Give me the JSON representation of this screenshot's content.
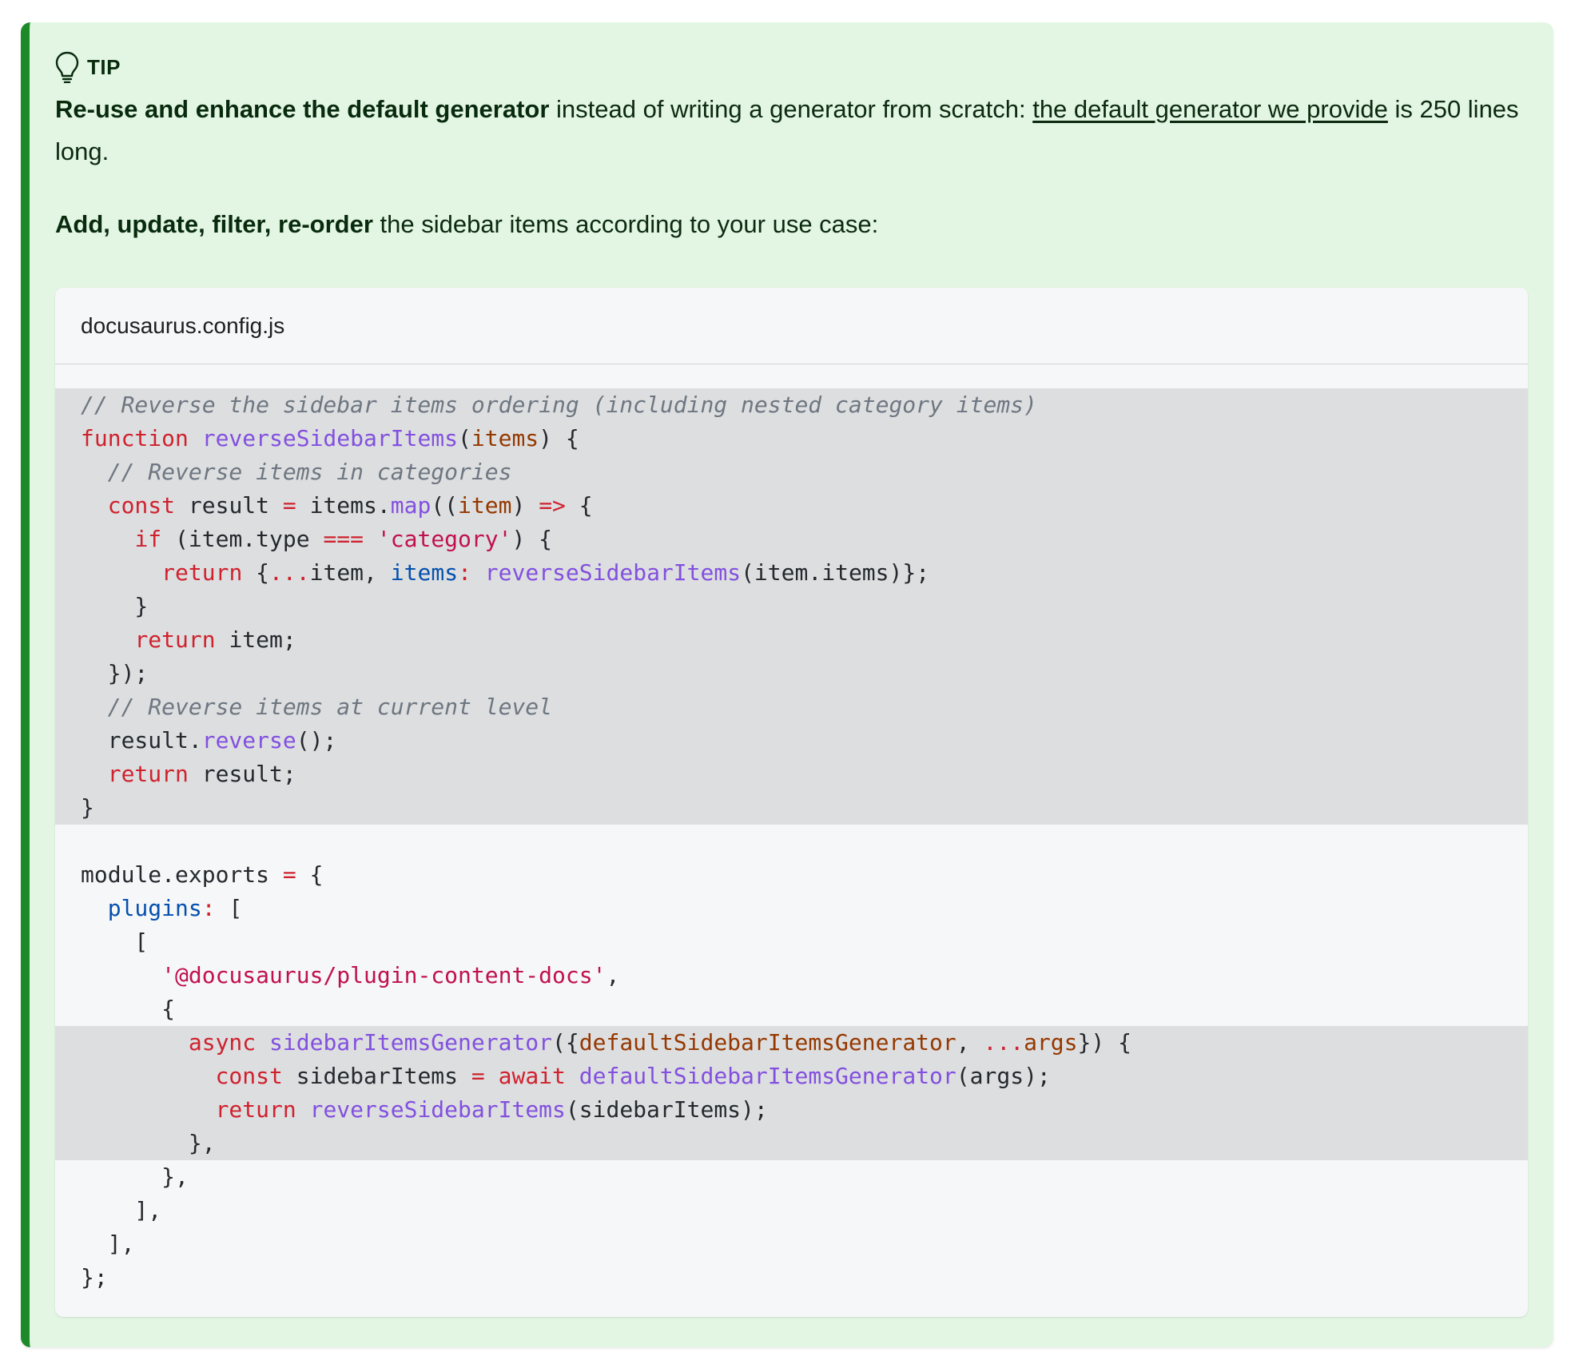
{
  "admonition": {
    "label": "tip",
    "icon": "lightbulb-icon",
    "paragraph1": {
      "bold": "Re-use and enhance the default generator",
      "text1": " instead of writing a generator from scratch: ",
      "link": "the default generator we provide",
      "text2": " is 250 lines long."
    },
    "paragraph2": {
      "bold": "Add, update, filter, re-order",
      "text": " the sidebar items according to your use case:"
    }
  },
  "code": {
    "title": "docusaurus.config.js",
    "lines": [
      {
        "hl": true,
        "tokens": [
          [
            "cm",
            "// Reverse the sidebar items ordering (including nested category items)"
          ]
        ]
      },
      {
        "hl": true,
        "tokens": [
          [
            "kw",
            "function"
          ],
          [
            "pl",
            " "
          ],
          [
            "fn",
            "reverseSidebarItems"
          ],
          [
            "pl",
            "("
          ],
          [
            "pr",
            "items"
          ],
          [
            "pl",
            ") {"
          ]
        ]
      },
      {
        "hl": true,
        "tokens": [
          [
            "pl",
            "  "
          ],
          [
            "cm",
            "// Reverse items in categories"
          ]
        ]
      },
      {
        "hl": true,
        "tokens": [
          [
            "pl",
            "  "
          ],
          [
            "kw",
            "const"
          ],
          [
            "pl",
            " result "
          ],
          [
            "op",
            "="
          ],
          [
            "pl",
            " items."
          ],
          [
            "fn",
            "map"
          ],
          [
            "pl",
            "(("
          ],
          [
            "pr",
            "item"
          ],
          [
            "pl",
            ") "
          ],
          [
            "op",
            "=>"
          ],
          [
            "pl",
            " {"
          ]
        ]
      },
      {
        "hl": true,
        "tokens": [
          [
            "pl",
            "    "
          ],
          [
            "kw",
            "if"
          ],
          [
            "pl",
            " (item.type "
          ],
          [
            "op",
            "==="
          ],
          [
            "pl",
            " "
          ],
          [
            "st",
            "'category'"
          ],
          [
            "pl",
            ") {"
          ]
        ]
      },
      {
        "hl": true,
        "tokens": [
          [
            "pl",
            "      "
          ],
          [
            "kw",
            "return"
          ],
          [
            "pl",
            " {"
          ],
          [
            "op",
            "..."
          ],
          [
            "pl",
            "item, "
          ],
          [
            "key",
            "items"
          ],
          [
            "op",
            ":"
          ],
          [
            "pl",
            " "
          ],
          [
            "fn",
            "reverseSidebarItems"
          ],
          [
            "pl",
            "(item.items)};"
          ]
        ]
      },
      {
        "hl": true,
        "tokens": [
          [
            "pl",
            "    }"
          ]
        ]
      },
      {
        "hl": true,
        "tokens": [
          [
            "pl",
            "    "
          ],
          [
            "kw",
            "return"
          ],
          [
            "pl",
            " item;"
          ]
        ]
      },
      {
        "hl": true,
        "tokens": [
          [
            "pl",
            "  });"
          ]
        ]
      },
      {
        "hl": true,
        "tokens": [
          [
            "pl",
            "  "
          ],
          [
            "cm",
            "// Reverse items at current level"
          ]
        ]
      },
      {
        "hl": true,
        "tokens": [
          [
            "pl",
            "  result."
          ],
          [
            "fn",
            "reverse"
          ],
          [
            "pl",
            "();"
          ]
        ]
      },
      {
        "hl": true,
        "tokens": [
          [
            "pl",
            "  "
          ],
          [
            "kw",
            "return"
          ],
          [
            "pl",
            " result;"
          ]
        ]
      },
      {
        "hl": true,
        "tokens": [
          [
            "pl",
            "}"
          ]
        ]
      },
      {
        "hl": false,
        "tokens": [
          [
            "pl",
            " "
          ]
        ]
      },
      {
        "hl": false,
        "tokens": [
          [
            "pl",
            "module.exports "
          ],
          [
            "op",
            "="
          ],
          [
            "pl",
            " {"
          ]
        ]
      },
      {
        "hl": false,
        "tokens": [
          [
            "pl",
            "  "
          ],
          [
            "key",
            "plugins"
          ],
          [
            "op",
            ":"
          ],
          [
            "pl",
            " ["
          ]
        ]
      },
      {
        "hl": false,
        "tokens": [
          [
            "pl",
            "    ["
          ]
        ]
      },
      {
        "hl": false,
        "tokens": [
          [
            "pl",
            "      "
          ],
          [
            "st",
            "'@docusaurus/plugin-content-docs'"
          ],
          [
            "pl",
            ","
          ]
        ]
      },
      {
        "hl": false,
        "tokens": [
          [
            "pl",
            "      {"
          ]
        ]
      },
      {
        "hl": true,
        "tokens": [
          [
            "pl",
            "        "
          ],
          [
            "kw",
            "async"
          ],
          [
            "pl",
            " "
          ],
          [
            "fn",
            "sidebarItemsGenerator"
          ],
          [
            "pl",
            "({"
          ],
          [
            "pr",
            "defaultSidebarItemsGenerator"
          ],
          [
            "pl",
            ", "
          ],
          [
            "op",
            "..."
          ],
          [
            "pr",
            "args"
          ],
          [
            "pl",
            "}) {"
          ]
        ]
      },
      {
        "hl": true,
        "tokens": [
          [
            "pl",
            "          "
          ],
          [
            "kw",
            "const"
          ],
          [
            "pl",
            " sidebarItems "
          ],
          [
            "op",
            "="
          ],
          [
            "pl",
            " "
          ],
          [
            "kw",
            "await"
          ],
          [
            "pl",
            " "
          ],
          [
            "fn",
            "defaultSidebarItemsGenerator"
          ],
          [
            "pl",
            "(args);"
          ]
        ]
      },
      {
        "hl": true,
        "tokens": [
          [
            "pl",
            "          "
          ],
          [
            "kw",
            "return"
          ],
          [
            "pl",
            " "
          ],
          [
            "fn",
            "reverseSidebarItems"
          ],
          [
            "pl",
            "(sidebarItems);"
          ]
        ]
      },
      {
        "hl": true,
        "tokens": [
          [
            "pl",
            "        },"
          ]
        ]
      },
      {
        "hl": false,
        "tokens": [
          [
            "pl",
            "      },"
          ]
        ]
      },
      {
        "hl": false,
        "tokens": [
          [
            "pl",
            "    ],"
          ]
        ]
      },
      {
        "hl": false,
        "tokens": [
          [
            "pl",
            "  ],"
          ]
        ]
      },
      {
        "hl": false,
        "tokens": [
          [
            "pl",
            "};"
          ]
        ]
      }
    ]
  }
}
